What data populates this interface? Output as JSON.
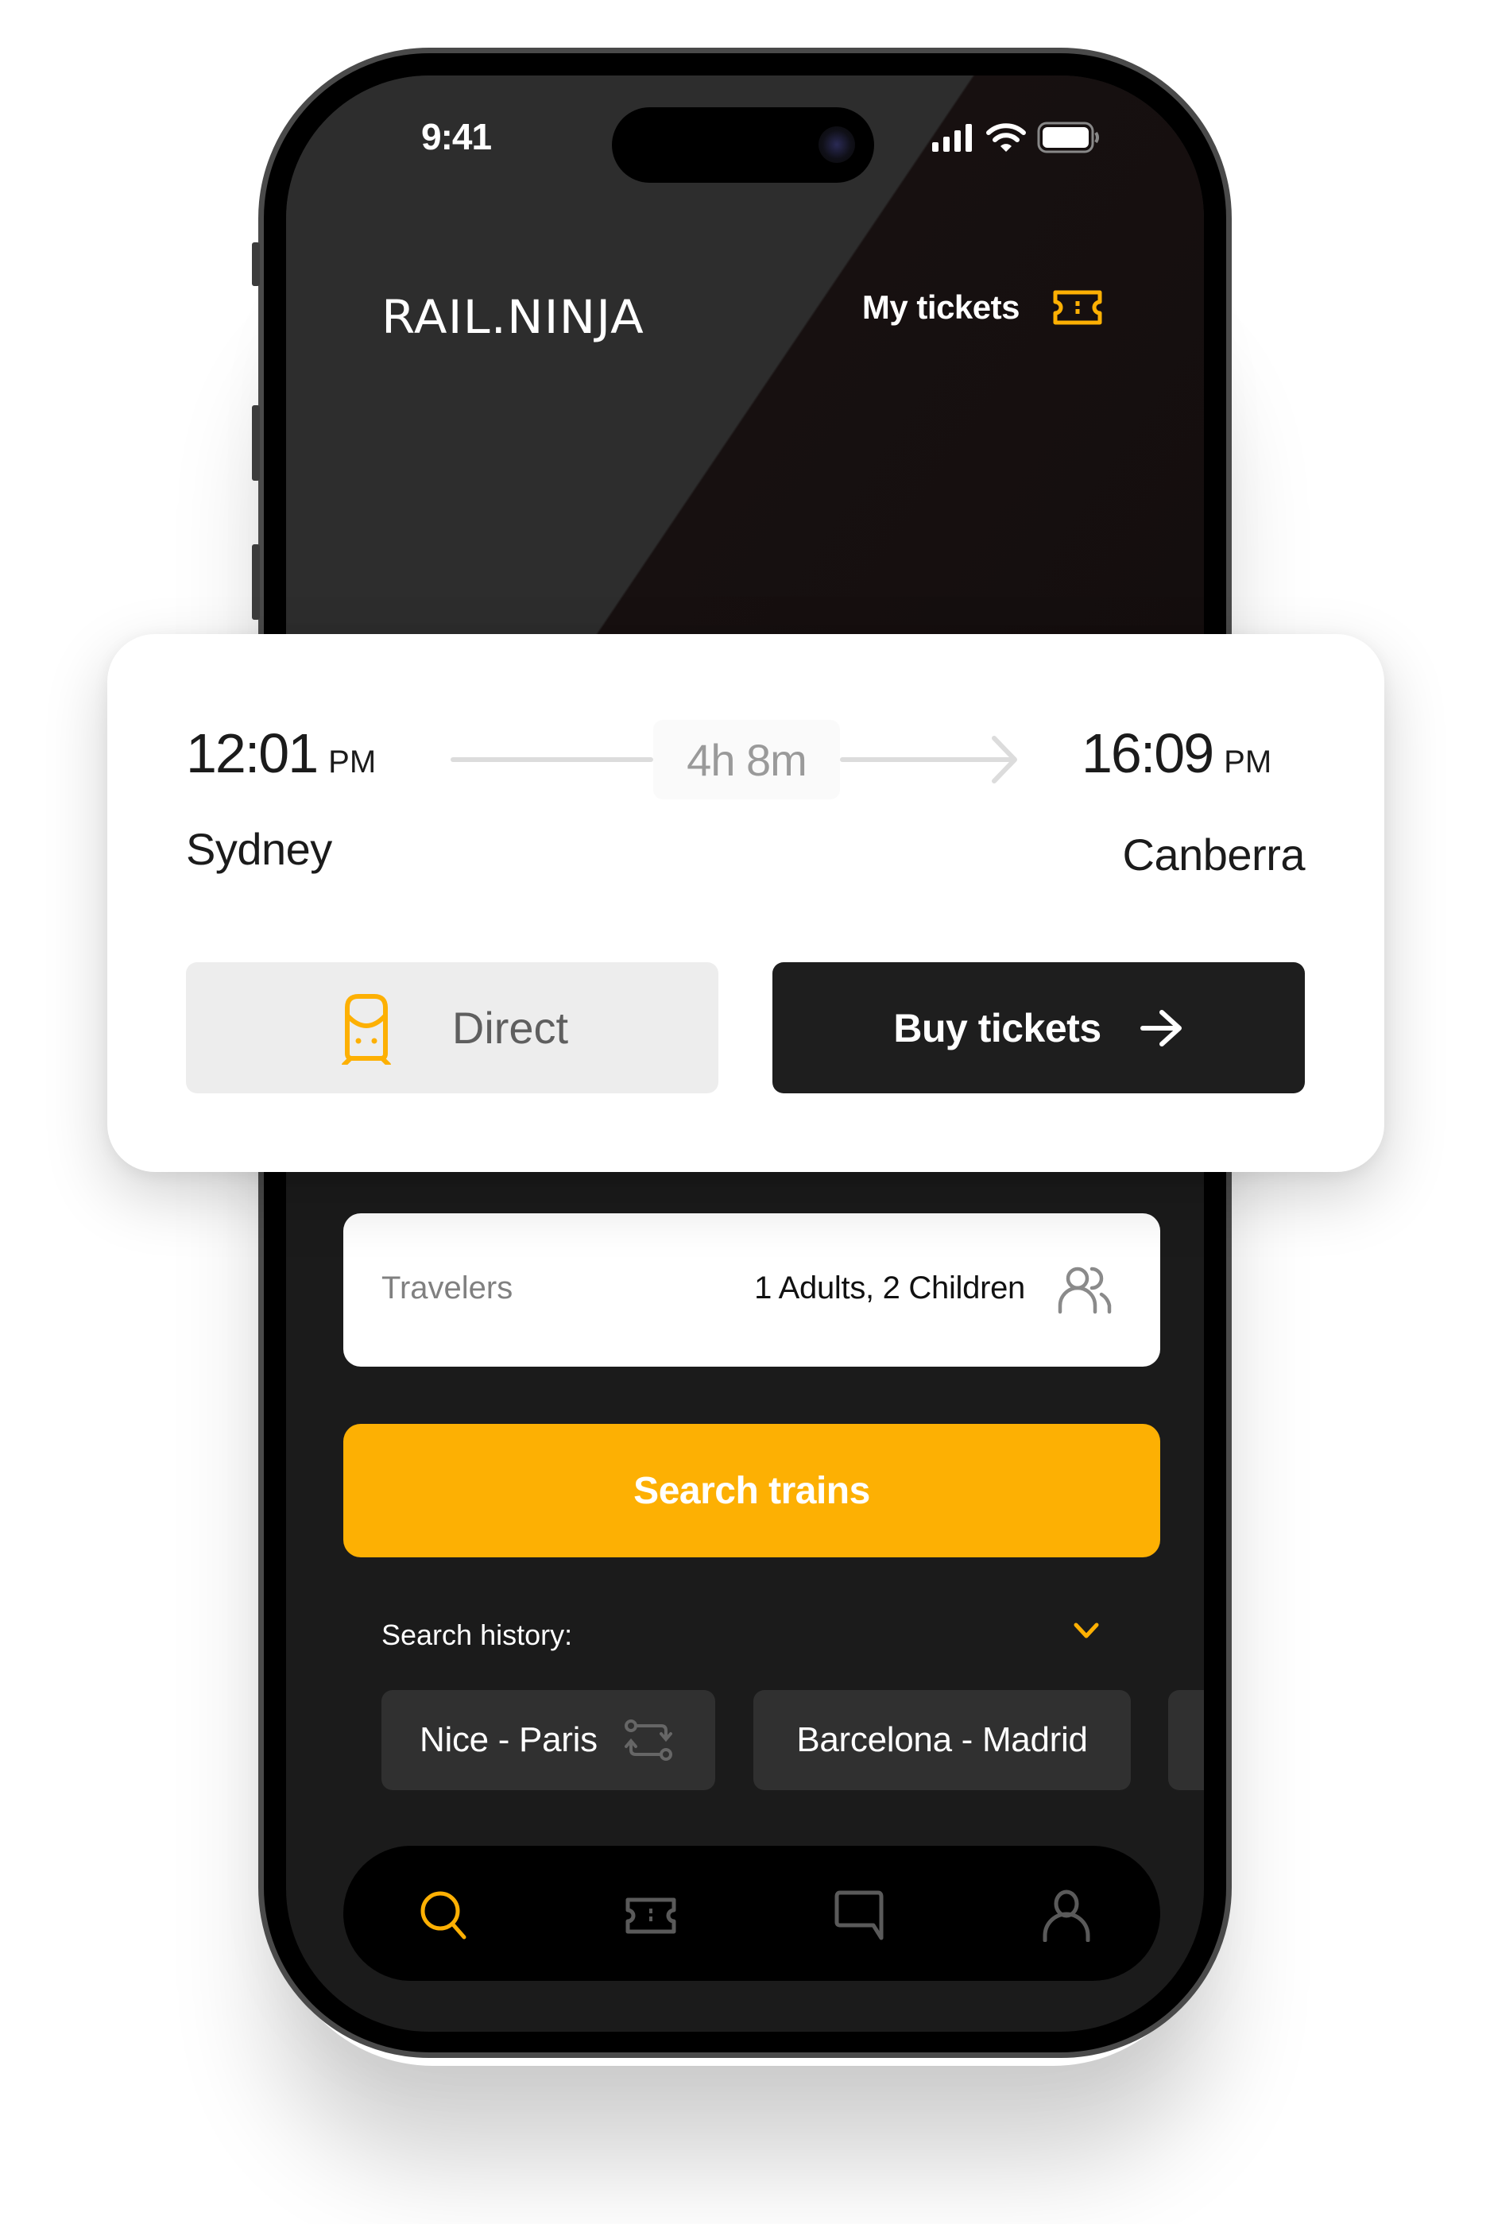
{
  "status_bar": {
    "time": "9:41",
    "icons": [
      "cellular-signal-icon",
      "wifi-icon",
      "battery-icon"
    ]
  },
  "header": {
    "logo": "RAIL.NINJA",
    "my_tickets_label": "My tickets",
    "my_tickets_icon": "ticket-icon"
  },
  "trip_card": {
    "departure": {
      "time": "12:01",
      "ampm": "PM",
      "city": "Sydney"
    },
    "arrival": {
      "time": "16:09",
      "ampm": "PM",
      "city": "Canberra"
    },
    "duration": "4h 8m",
    "direct_label": "Direct",
    "direct_icon": "train-icon",
    "buy_label": "Buy tickets",
    "buy_icon": "arrow-right-icon"
  },
  "search_form": {
    "travelers_label": "Travelers",
    "travelers_value": "1 Adults, 2 Children",
    "travelers_icon": "users-icon",
    "search_button": "Search trains"
  },
  "search_history": {
    "label": "Search history:",
    "toggle_icon": "chevron-down-icon",
    "items": [
      {
        "label": "Nice - Paris",
        "icon": "swap-route-icon"
      },
      {
        "label": "Barcelona - Madrid"
      }
    ]
  },
  "bottom_nav": {
    "items": [
      {
        "name": "search",
        "icon": "search-icon",
        "active": true
      },
      {
        "name": "tickets",
        "icon": "ticket-icon",
        "active": false
      },
      {
        "name": "messages",
        "icon": "chat-icon",
        "active": false
      },
      {
        "name": "profile",
        "icon": "user-icon",
        "active": false
      }
    ]
  },
  "colors": {
    "accent": "#fdb003",
    "screen_bg": "#1b1b1b",
    "card_bg": "#ffffff",
    "dark_button": "#1e1e1e",
    "inactive_icon": "#5a5a5a"
  }
}
